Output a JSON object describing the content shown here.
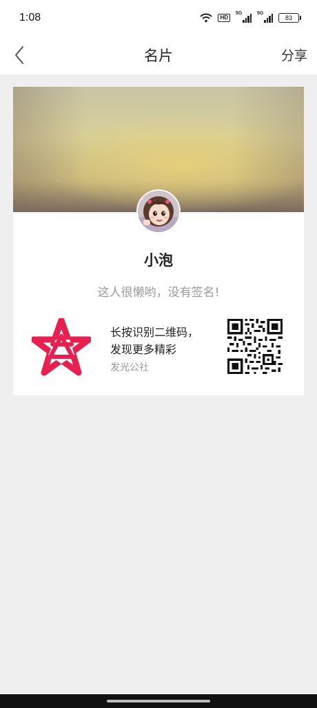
{
  "status_bar": {
    "time": "1:08",
    "battery": "83",
    "hd_label": "HD",
    "network_labels": [
      "5G",
      "5G"
    ]
  },
  "nav": {
    "title": "名片",
    "share_label": "分享",
    "back_icon": "chevron-left-icon"
  },
  "profile": {
    "name": "小泡",
    "signature": "这人很懒哟，没有签名!"
  },
  "promo": {
    "line1": "长按识别二维码，",
    "line2": "发现更多精彩",
    "org_name": "发光公社",
    "logo_color": "#e8204f"
  },
  "colors": {
    "accent": "#e8204f",
    "page_bg": "#efefef",
    "muted_text": "#9a9a9a"
  }
}
